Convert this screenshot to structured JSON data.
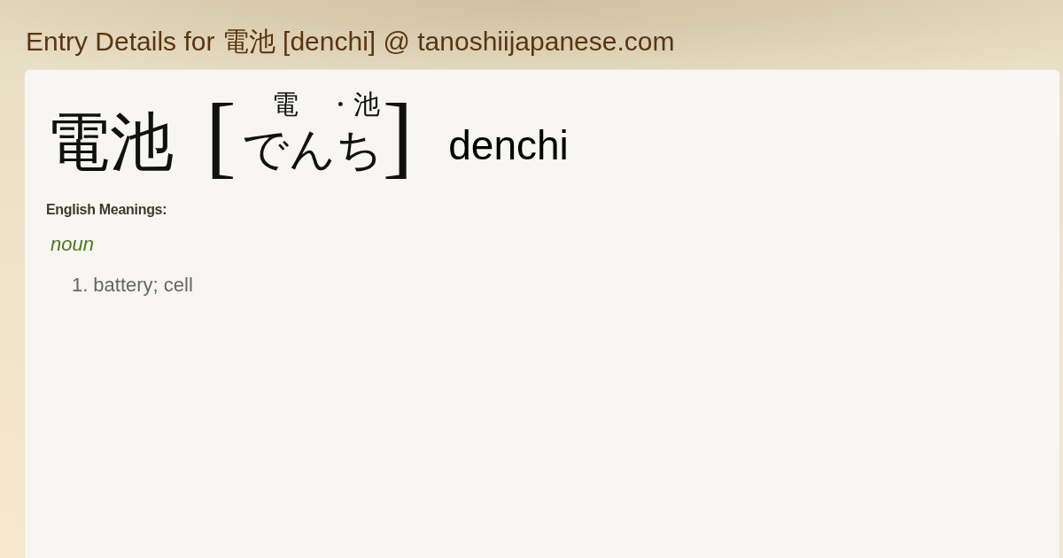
{
  "page_title": "Entry Details for 電池 [denchi] @ tanoshiijapanese.com",
  "entry": {
    "headword": "電池",
    "reading": {
      "open_bracket": "[",
      "kanji_marks": [
        "電",
        "・池"
      ],
      "kana": "でんち",
      "close_bracket": "]"
    },
    "romaji": "denchi",
    "meanings_label": "English Meanings:",
    "meaning_groups": [
      {
        "part_of_speech": "noun",
        "senses": [
          {
            "number": "1.",
            "text": "battery; cell"
          }
        ]
      }
    ]
  }
}
